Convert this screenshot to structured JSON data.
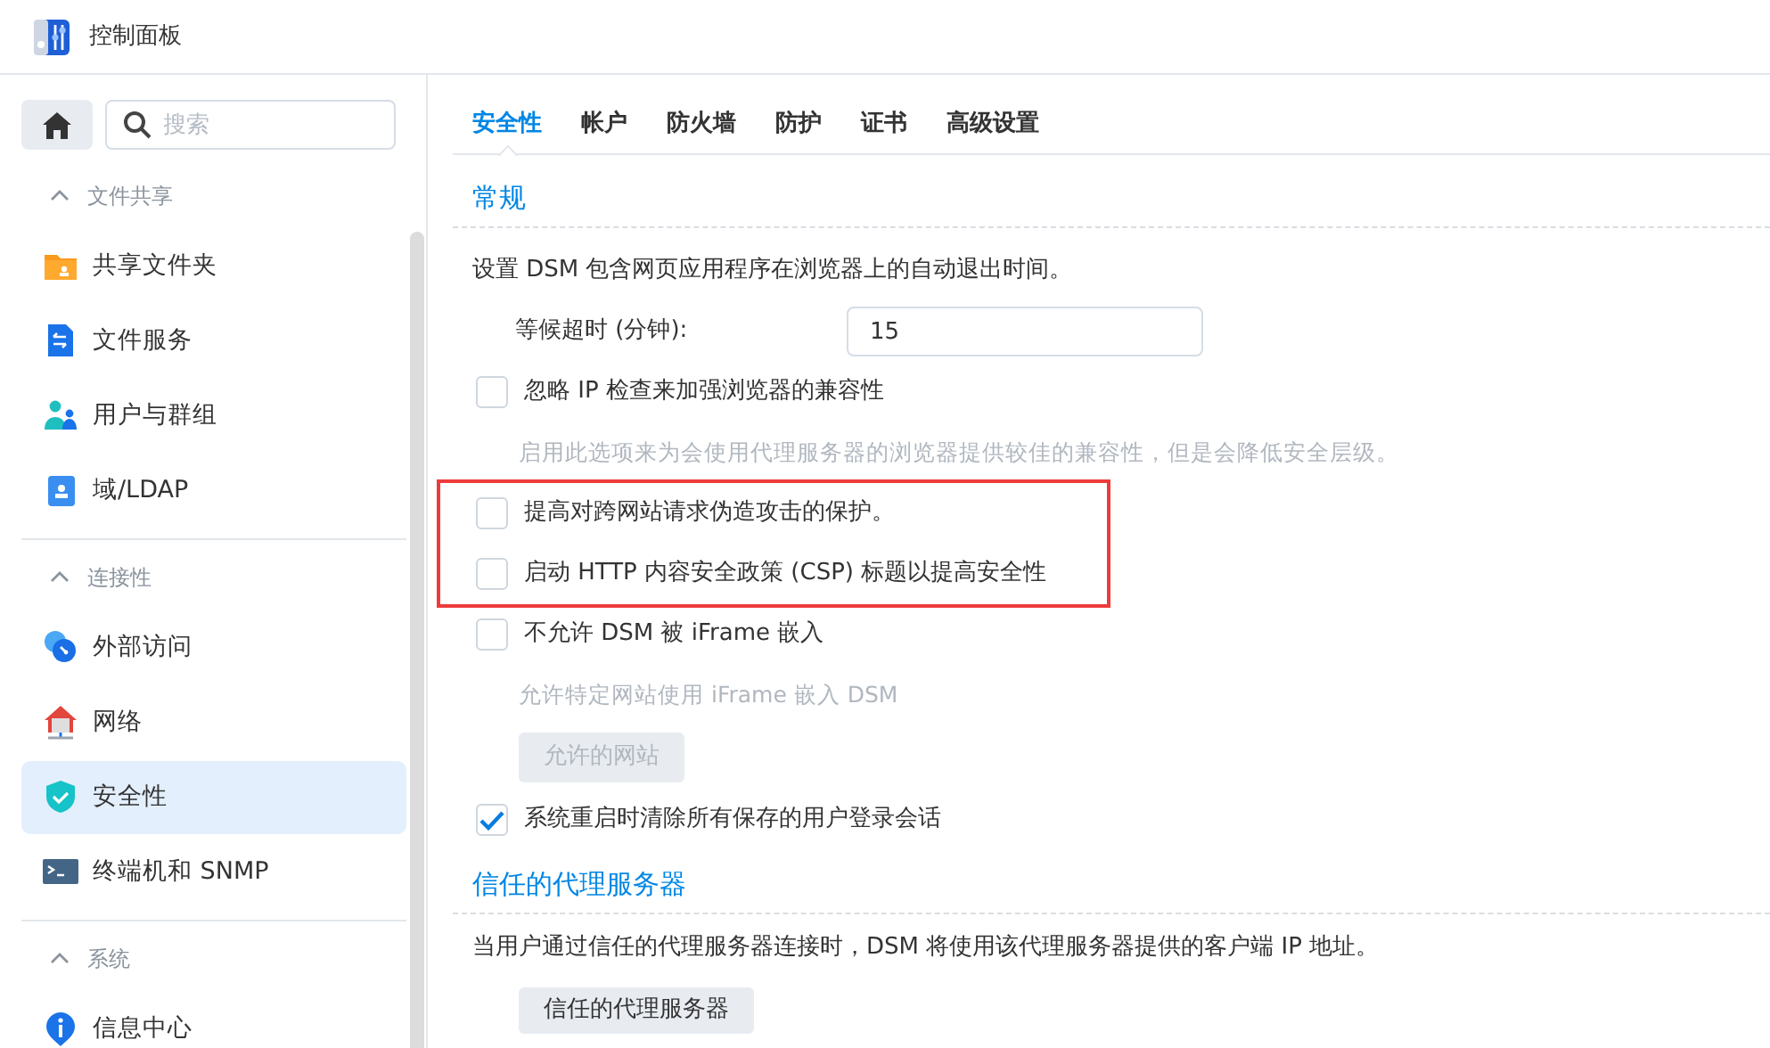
{
  "window": {
    "title": "控制面板"
  },
  "sidebar": {
    "search": {
      "placeholder": "搜索"
    },
    "groups": [
      {
        "label": "文件共享",
        "expanded": true,
        "items": [
          {
            "label": "共享文件夹",
            "kind": "folder",
            "selected": false
          },
          {
            "label": "文件服务",
            "kind": "fileservice",
            "selected": false
          },
          {
            "label": "用户与群组",
            "kind": "users",
            "selected": false
          },
          {
            "label": "域/LDAP",
            "kind": "ldap",
            "selected": false
          }
        ]
      },
      {
        "label": "连接性",
        "expanded": true,
        "items": [
          {
            "label": "外部访问",
            "kind": "external",
            "selected": false
          },
          {
            "label": "网络",
            "kind": "network",
            "selected": false
          },
          {
            "label": "安全性",
            "kind": "shield",
            "selected": true
          },
          {
            "label": "终端机和 SNMP",
            "kind": "terminal",
            "selected": false
          }
        ]
      },
      {
        "label": "系统",
        "expanded": true,
        "items": [
          {
            "label": "信息中心",
            "kind": "info",
            "selected": false
          }
        ]
      }
    ]
  },
  "tabs": [
    {
      "label": "安全性",
      "selected": true
    },
    {
      "label": "帐户",
      "selected": false
    },
    {
      "label": "防火墙",
      "selected": false
    },
    {
      "label": "防护",
      "selected": false
    },
    {
      "label": "证书",
      "selected": false
    },
    {
      "label": "高级设置",
      "selected": false
    }
  ],
  "sections": [
    {
      "title": "常规",
      "items": [
        {
          "kind": "text",
          "text": "设置 DSM 包含网页应用程序在浏览器上的自动退出时间。"
        },
        {
          "kind": "field",
          "label": "等候超时 (分钟):",
          "value": "15"
        },
        {
          "kind": "checkbox",
          "label": "忽略 IP 检查来加强浏览器的兼容性",
          "checked": false,
          "highlighted": false
        },
        {
          "kind": "hint",
          "text": "启用此选项来为会使用代理服务器的浏览器提供较佳的兼容性，但是会降低安全层级。"
        },
        {
          "kind": "checkbox",
          "label": "提高对跨网站请求伪造攻击的保护。",
          "checked": false,
          "highlighted": true
        },
        {
          "kind": "checkbox",
          "label": "启动 HTTP 内容安全政策 (CSP) 标题以提高安全性",
          "checked": false,
          "highlighted": true
        },
        {
          "kind": "checkbox",
          "label": "不允许 DSM 被 iFrame 嵌入",
          "checked": false,
          "highlighted": false
        },
        {
          "kind": "hint",
          "text": "允许特定网站使用 iFrame 嵌入 DSM"
        },
        {
          "kind": "button",
          "label": "允许的网站",
          "disabled": true
        },
        {
          "kind": "checkbox",
          "label": "系统重启时清除所有保存的用户登录会话",
          "checked": true,
          "highlighted": false
        }
      ]
    },
    {
      "title": "信任的代理服务器",
      "items": [
        {
          "kind": "text",
          "text": "当用户通过信任的代理服务器连接时，DSM 将使用该代理服务器提供的客户端 IP 地址。"
        },
        {
          "kind": "button",
          "label": "信任的代理服务器",
          "disabled": false
        }
      ]
    }
  ]
}
